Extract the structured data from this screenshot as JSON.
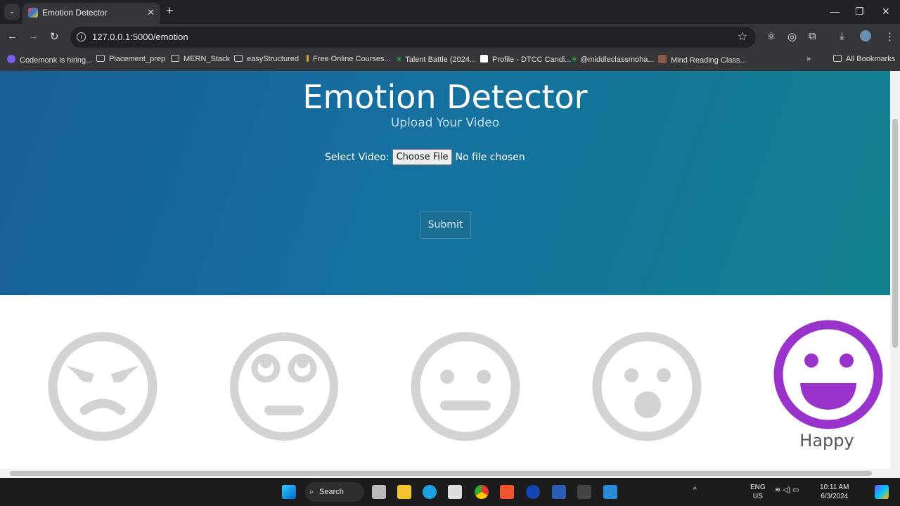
{
  "browser": {
    "tab_title": "Emotion Detector",
    "url": "127.0.0.1:5000/emotion",
    "bookmarks": [
      "Codemonk is hiring...",
      "Placement_prep",
      "MERN_Stack",
      "easyStructured",
      "Free Online Courses...",
      "Talent Battle (2024...",
      "Profile - DTCC Candi...",
      "@middleclassmoha...",
      "Mind Reading Class..."
    ],
    "all_bookmarks": "All Bookmarks"
  },
  "page": {
    "title": "Emotion Detector",
    "subtitle": "Upload Your Video",
    "select_label": "Select Video:",
    "choose_file": "Choose File",
    "no_file": "No file chosen",
    "submit": "Submit",
    "faces": [
      {
        "emotion": "angry",
        "active": false
      },
      {
        "emotion": "eye-roll",
        "active": false
      },
      {
        "emotion": "neutral",
        "active": false
      },
      {
        "emotion": "surprised",
        "active": false
      },
      {
        "emotion": "happy",
        "active": true
      }
    ],
    "detected_label": "Happy",
    "active_color": "#9933cc",
    "inactive_color": "#d3d3d3"
  },
  "taskbar": {
    "search": "Search",
    "lang": "ENG",
    "region": "US",
    "time": "10:11 AM",
    "date": "6/3/2024"
  }
}
